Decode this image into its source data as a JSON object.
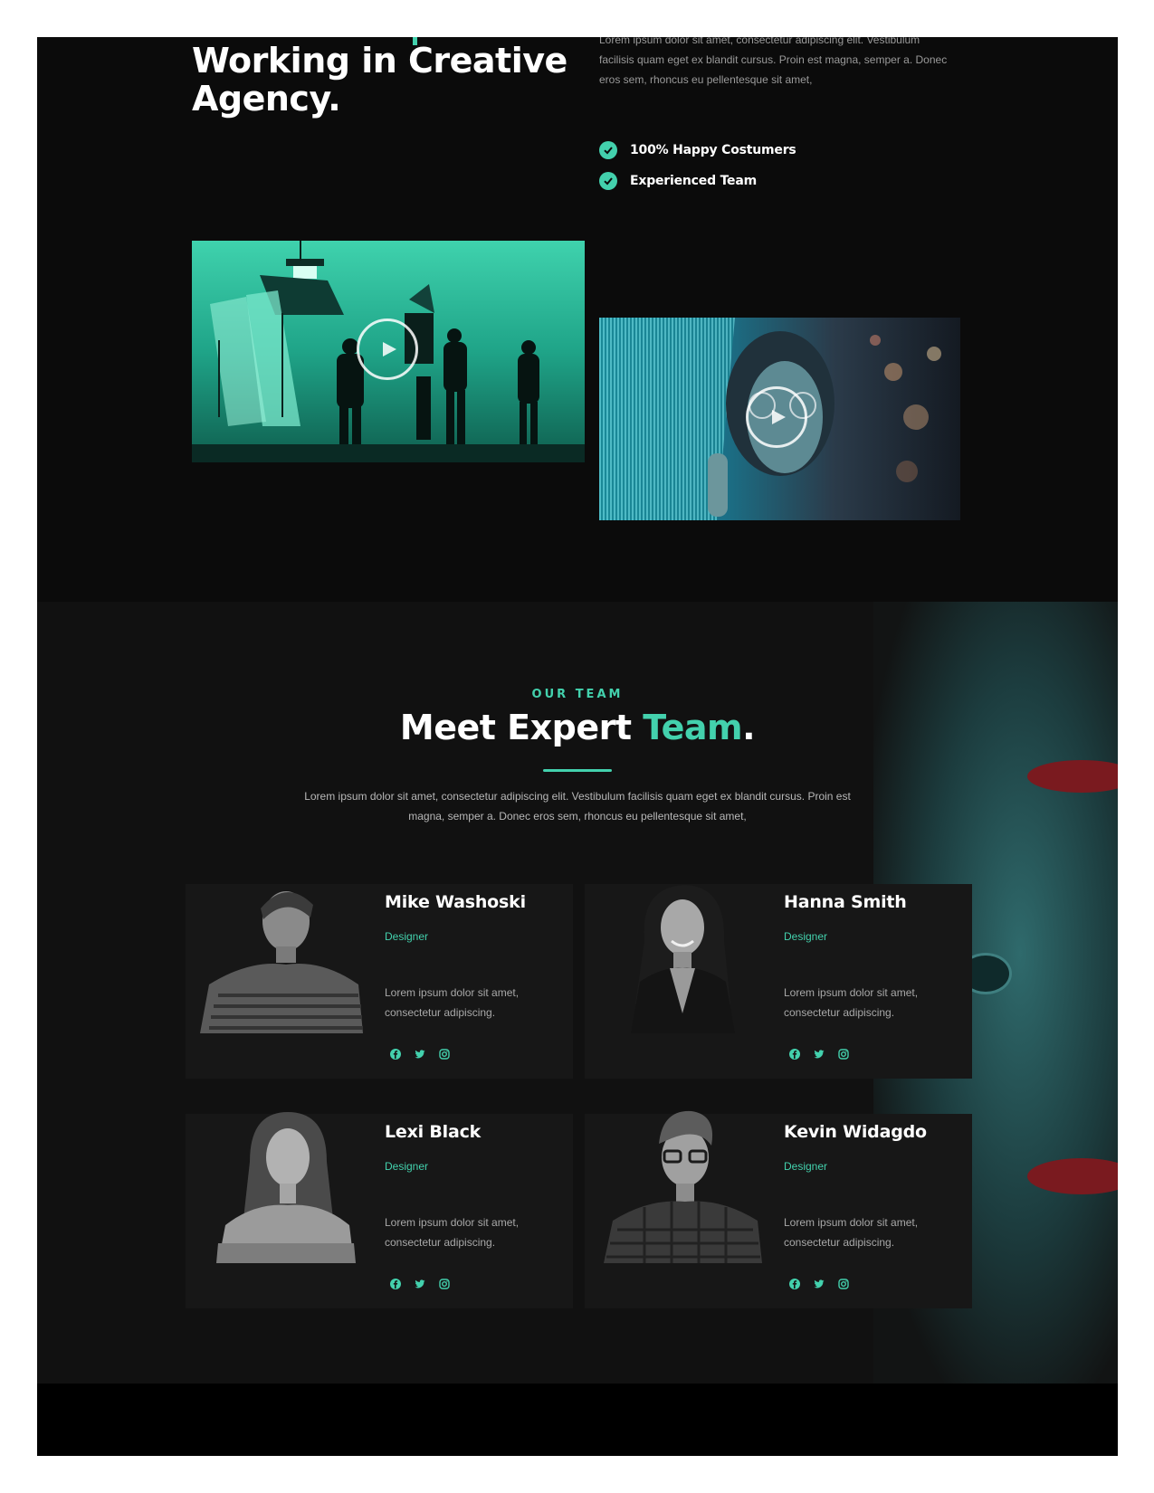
{
  "about": {
    "title_line1": "Working in Creative",
    "title_line2": "Agency.",
    "description_top": "Lorem ipsum dolor sit amet, consectetur adipiscing elit. Vestibulum",
    "description": "facilisis quam eget ex blandit cursus. Proin est magna, semper a. Donec eros sem, rhoncus eu pellentesque sit amet,",
    "checks": [
      {
        "label": "100% Happy Costumers",
        "icon": "check-circle-icon"
      },
      {
        "label": "Experienced Team",
        "icon": "check-circle-icon"
      }
    ],
    "videos": [
      {
        "icon": "play-icon",
        "scene": "film studio set"
      },
      {
        "icon": "play-icon",
        "scene": "woman with glasses"
      }
    ]
  },
  "team": {
    "subtitle": "OUR TEAM",
    "title_part1": "Meet Expert ",
    "title_accent": "Team",
    "title_end": ".",
    "intro": "Lorem ipsum dolor sit amet, consectetur adipiscing elit. Vestibulum facilisis quam eget ex blandit cursus. Proin est magna, semper a. Donec eros sem, rhoncus eu pellentesque sit amet,",
    "members": [
      {
        "name": "Mike Washoski",
        "role": "Designer",
        "bio": "Lorem ipsum dolor sit amet, consectetur adipiscing."
      },
      {
        "name": "Hanna Smith",
        "role": "Designer",
        "bio": "Lorem ipsum dolor sit amet, consectetur adipiscing."
      },
      {
        "name": "Lexi Black",
        "role": "Designer",
        "bio": "Lorem ipsum dolor sit amet, consectetur adipiscing."
      },
      {
        "name": "Kevin Widagdo",
        "role": "Designer",
        "bio": "Lorem ipsum dolor sit amet, consectetur adipiscing."
      }
    ],
    "social_icons": [
      "facebook-icon",
      "twitter-icon",
      "instagram-icon"
    ]
  },
  "colors": {
    "accent": "#43d1ad",
    "background": "#0b0b0b",
    "card": "#171717",
    "text": "#ffffff",
    "muted": "#a8a8a8"
  }
}
